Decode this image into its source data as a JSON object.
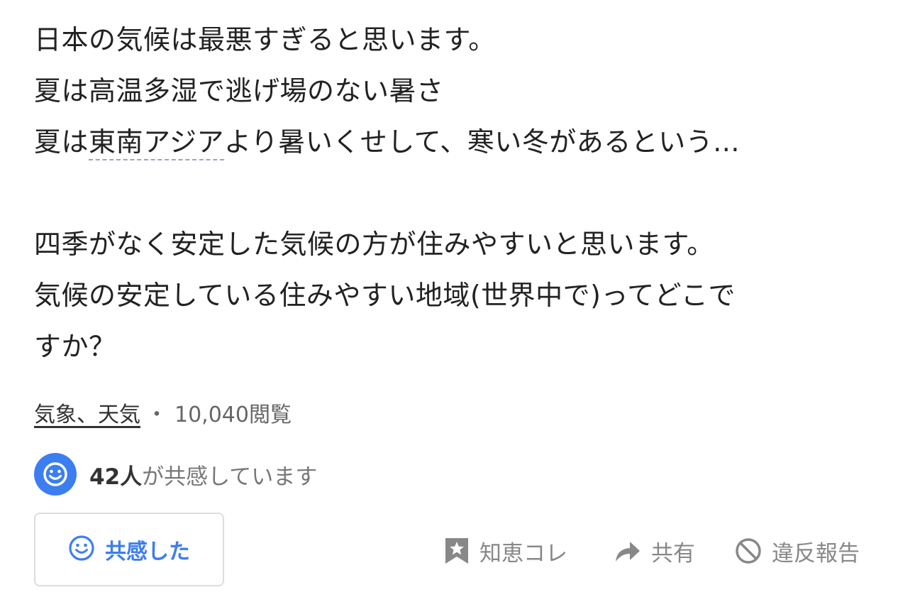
{
  "question": {
    "lines": [
      "日本の気候は最悪すぎると思います。",
      "夏は高温多湿で逃げ場のない暑さ"
    ],
    "line3_prefix": "夏は",
    "line3_link": "東南アジア",
    "line3_suffix": "より暑いくせして、寒い冬があるという...",
    "line4": "四季がなく安定した気候の方が住みやすいと思います。",
    "line5": "気候の安定している住みやすい地域(世界中で)ってどこで",
    "line6": "すか？"
  },
  "meta": {
    "category": "気象、天気",
    "separator": "・",
    "views": "10,040閲覧"
  },
  "empathy": {
    "icon": "smile-icon",
    "count": "42人",
    "text": "が共感しています",
    "button_label": "共感した",
    "accent": "#3c7ef0"
  },
  "actions": {
    "bookmark_label": "知恵コレ",
    "bookmark_icon": "bookmark-star-icon",
    "share_label": "共有",
    "share_icon": "share-arrow-icon",
    "report_label": "違反報告",
    "report_icon": "prohibit-icon"
  }
}
